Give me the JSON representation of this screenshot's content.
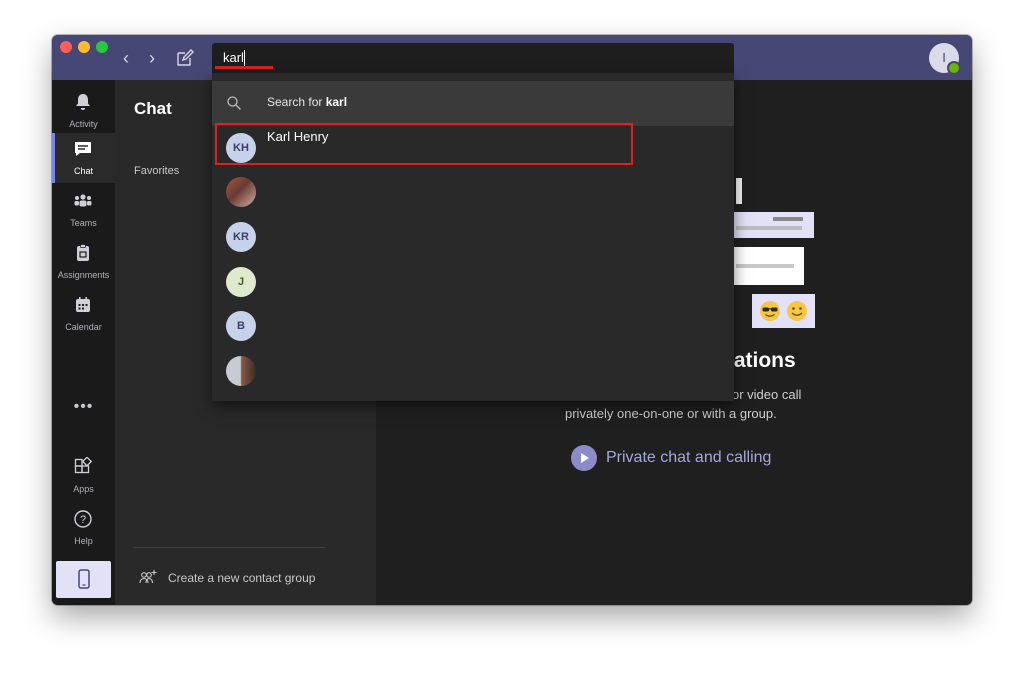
{
  "titlebar": {
    "search_value": "karl",
    "profile_initial": "I"
  },
  "rail": {
    "items": [
      {
        "label": "Activity",
        "icon": "bell-icon"
      },
      {
        "label": "Chat",
        "icon": "chat-icon"
      },
      {
        "label": "Teams",
        "icon": "teams-icon"
      },
      {
        "label": "Assignments",
        "icon": "assignments-icon"
      },
      {
        "label": "Calendar",
        "icon": "calendar-icon"
      },
      {
        "label": "Apps",
        "icon": "apps-icon"
      },
      {
        "label": "Help",
        "icon": "help-icon"
      }
    ],
    "more": "•••",
    "active": "Chat"
  },
  "chat_panel": {
    "title": "Chat",
    "favorites": "Favorites",
    "new_contact_group": "Create a new contact group"
  },
  "main": {
    "heading_fragment": "rsations",
    "desc_line1_fragment": "or video call",
    "desc_line2": "privately one-on-one or with a group.",
    "link": "Private chat and calling"
  },
  "dropdown": {
    "search_prefix": "Search for",
    "search_term": "karl",
    "results": [
      {
        "initials": "KH",
        "name": "Karl Henry",
        "avatar": "blue"
      },
      {
        "initials": "",
        "name": "",
        "avatar": "photo"
      },
      {
        "initials": "KR",
        "name": "",
        "avatar": "blue"
      },
      {
        "initials": "J",
        "name": "",
        "avatar": "green"
      },
      {
        "initials": "B",
        "name": "",
        "avatar": "blue"
      },
      {
        "initials": "",
        "name": "",
        "avatar": "photo"
      }
    ]
  },
  "colors": {
    "titlebar": "#464775",
    "accent": "#7b83eb",
    "highlight": "#e02020",
    "presence": "#6bb700"
  }
}
